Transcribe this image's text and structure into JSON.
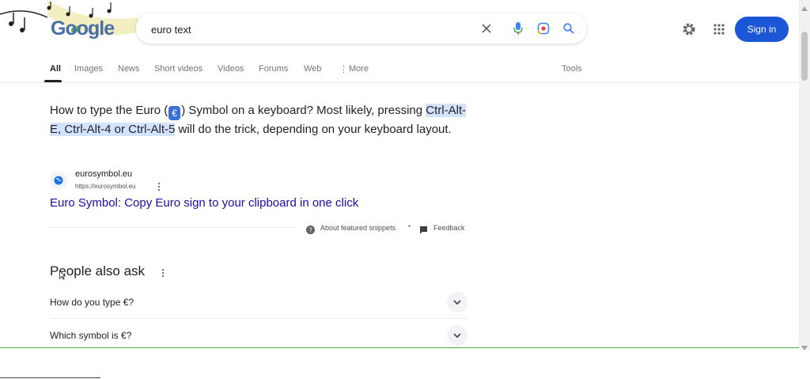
{
  "logo": {
    "text": "Google"
  },
  "search": {
    "query": "euro text",
    "placeholder": ""
  },
  "header": {
    "sign_in_label": "Sign in"
  },
  "tabs": [
    {
      "label": "All",
      "active": true
    },
    {
      "label": "Images"
    },
    {
      "label": "News"
    },
    {
      "label": "Short videos"
    },
    {
      "label": "Videos"
    },
    {
      "label": "Forums"
    },
    {
      "label": "Web"
    },
    {
      "label": "More"
    }
  ],
  "tools_label": "Tools",
  "snippet": {
    "part1": "How to type the Euro (",
    "badge": "€",
    "part2": ") Symbol on a keyboard? Most likely, pressing ",
    "highlight": "Ctrl-Alt-E, Ctrl-Alt-4 or Ctrl-Alt-5",
    "part3": " will do the trick, depending on your keyboard layout."
  },
  "source": {
    "name": "eurosymbol.eu",
    "url": "https://eurosymbol.eu",
    "title": "Euro Symbol: Copy Euro sign to your clipboard in one click"
  },
  "snippet_footer": {
    "about_label": "About featured snippets",
    "separator": "•",
    "feedback_label": "Feedback"
  },
  "people_also_ask": {
    "title": "People also ask",
    "questions": [
      "How do you type €?",
      "Which symbol is €?"
    ]
  },
  "colors": {
    "sign_in_bg": "#1a56d6",
    "link": "#1a0dab",
    "highlight": "#d3e3fd",
    "accent_line": "#3cb24a"
  },
  "icons": [
    "music-notes-doodle",
    "clear-icon",
    "microphone-icon",
    "lens-icon",
    "search-icon",
    "gear-icon",
    "apps-grid-icon",
    "globe-favicon",
    "kebab-menu-icon",
    "question-circle-icon",
    "feedback-icon",
    "chevron-down-icon",
    "mouse-cursor-icon"
  ]
}
